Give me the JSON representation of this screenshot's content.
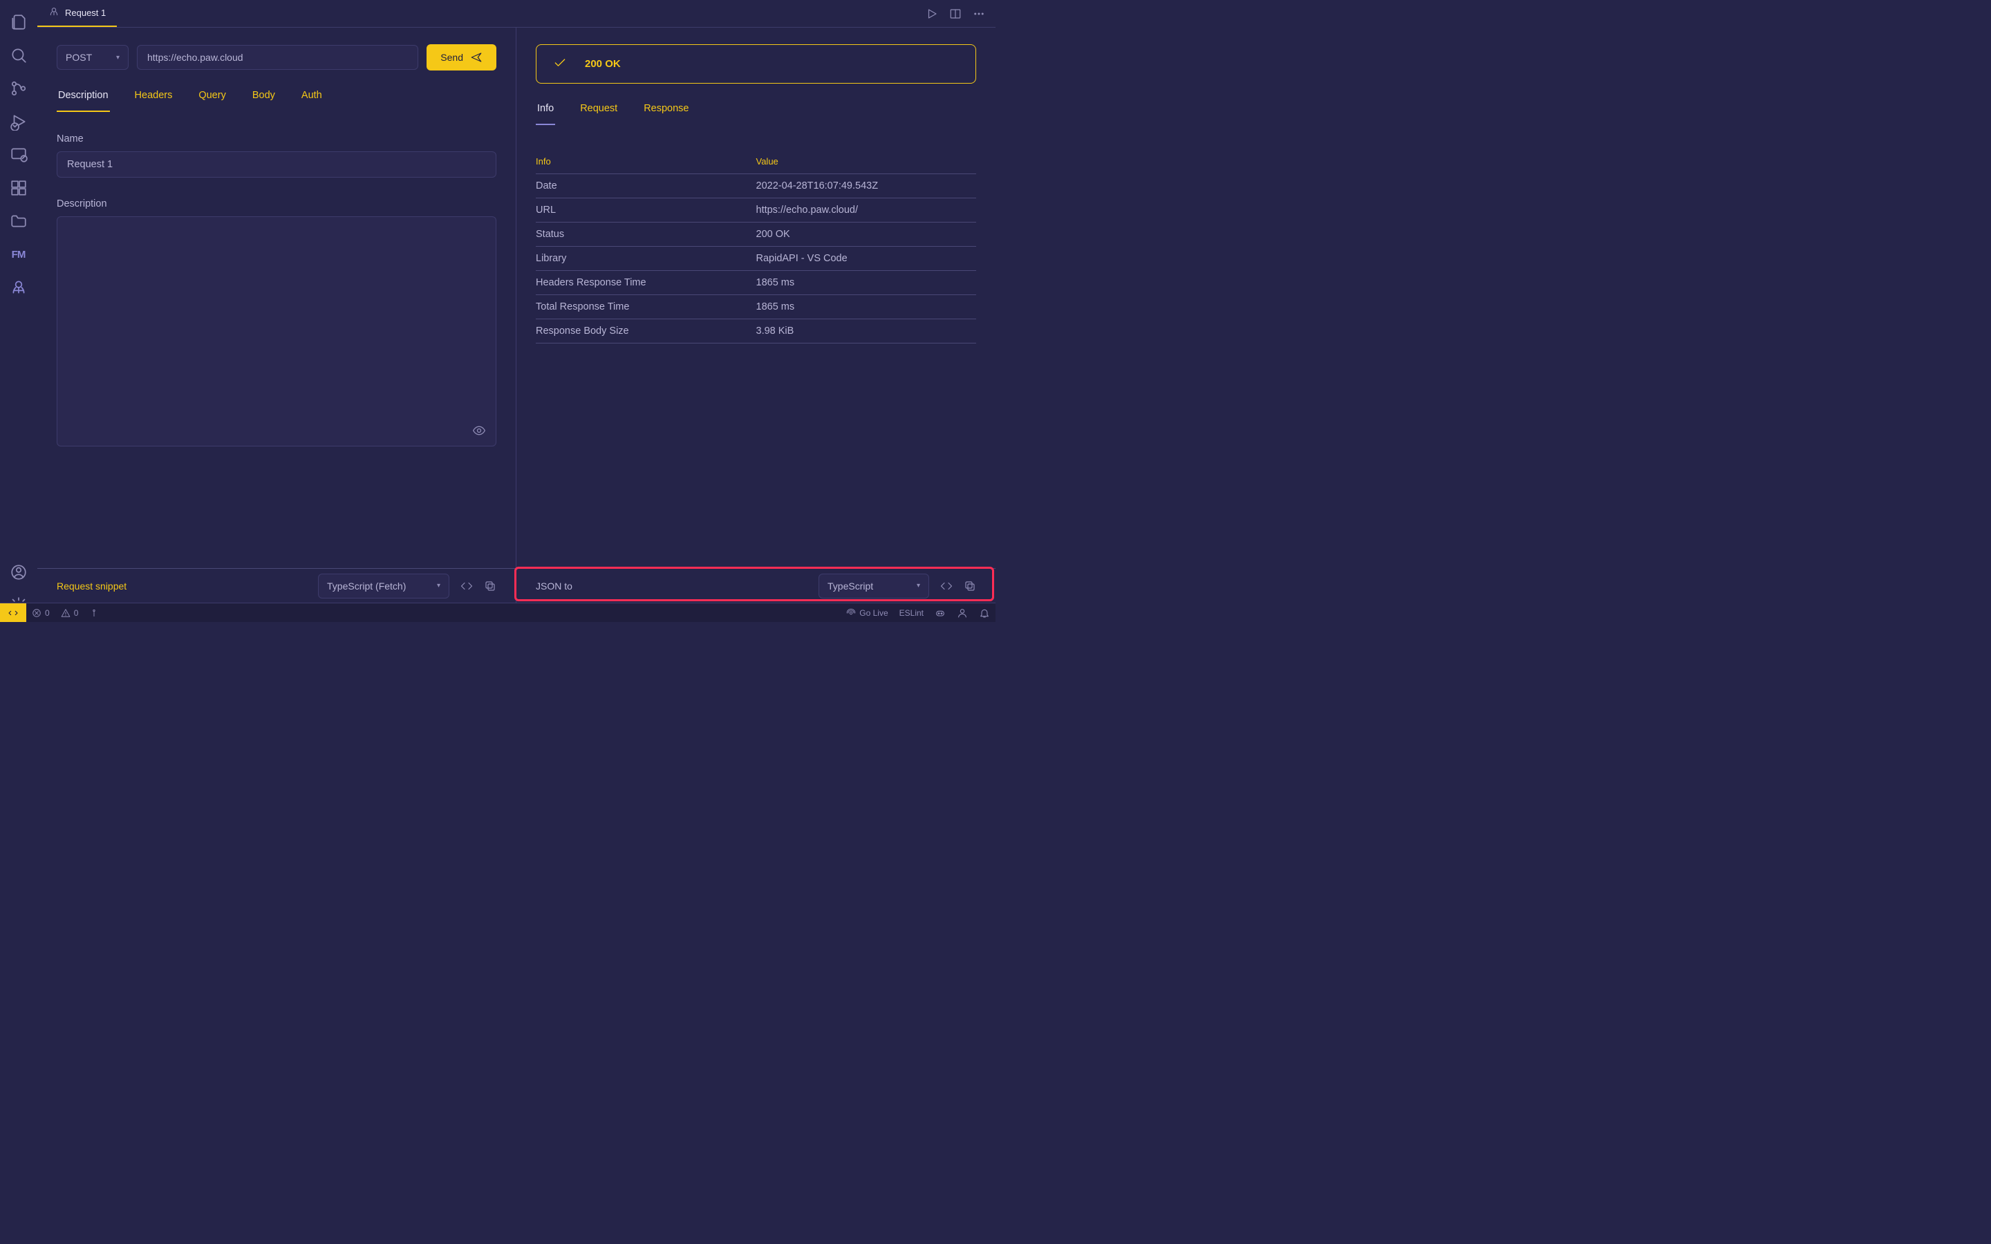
{
  "tab": {
    "title": "Request 1"
  },
  "request": {
    "method": "POST",
    "url": "https://echo.paw.cloud",
    "send_label": "Send"
  },
  "left_tabs": [
    "Description",
    "Headers",
    "Query",
    "Body",
    "Auth"
  ],
  "left_active": 0,
  "form": {
    "name_label": "Name",
    "name_value": "Request 1",
    "desc_label": "Description",
    "desc_value": ""
  },
  "response": {
    "status_text": "200 OK"
  },
  "right_tabs": [
    "Info",
    "Request",
    "Response"
  ],
  "right_active": 0,
  "info_headers": {
    "key": "Info",
    "value": "Value"
  },
  "info_rows": [
    {
      "k": "Date",
      "v": "2022-04-28T16:07:49.543Z"
    },
    {
      "k": "URL",
      "v": "https://echo.paw.cloud/"
    },
    {
      "k": "Status",
      "v": "200 OK"
    },
    {
      "k": "Library",
      "v": "RapidAPI - VS Code"
    },
    {
      "k": "Headers Response Time",
      "v": "1865 ms"
    },
    {
      "k": "Total Response Time",
      "v": "1865 ms"
    },
    {
      "k": "Response Body Size",
      "v": "3.98 KiB"
    }
  ],
  "snippet": {
    "left_label": "Request snippet",
    "left_lang": "TypeScript (Fetch)",
    "right_label": "JSON to",
    "right_lang": "TypeScript"
  },
  "statusbar": {
    "errors": "0",
    "warnings": "0",
    "go_live": "Go Live",
    "eslint": "ESLint"
  }
}
